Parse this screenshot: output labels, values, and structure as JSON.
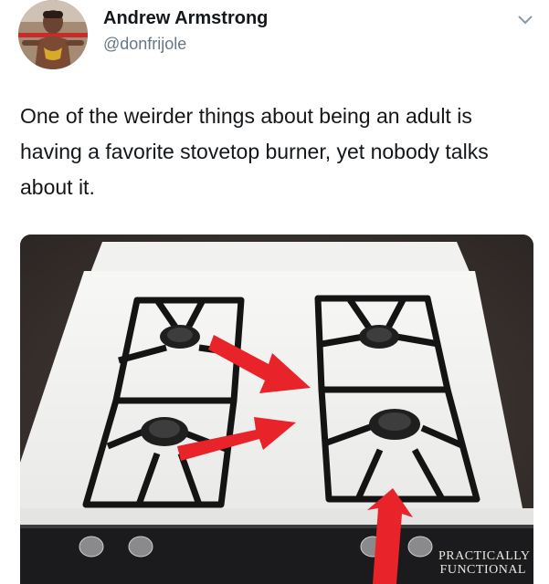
{
  "tweet": {
    "author_name": "Andrew Armstrong",
    "author_handle": "@donfrijole",
    "text": "One of the weirder things about being an adult is having a favorite stovetop burner, yet nobody talks about it."
  },
  "icons": {
    "avatar": "avatar-photo",
    "more_menu": "chevron-down-icon"
  },
  "photo": {
    "subject": "white gas stovetop with four burners, red arrows pointing at the two right burners",
    "watermark_line1": "Practically",
    "watermark_line2": "Functional"
  },
  "colors": {
    "text": "#14171a",
    "secondary_text": "#657786",
    "arrow": "#e8232a"
  }
}
